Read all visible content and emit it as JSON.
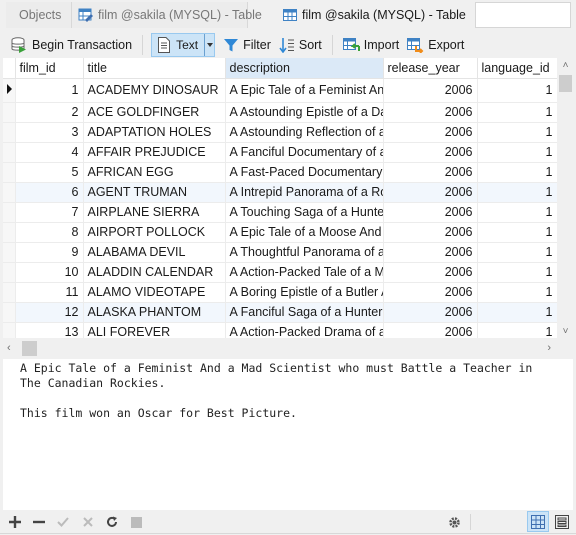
{
  "tabs": [
    {
      "label": "Objects",
      "icon": "none",
      "active": false
    },
    {
      "label": "film @sakila (MYSQL) - Table",
      "icon": "table-design-icon",
      "active": false
    },
    {
      "label": "film @sakila (MYSQL) - Table",
      "icon": "table-icon",
      "active": true
    }
  ],
  "toolbar": {
    "begin_transaction": "Begin Transaction",
    "text": "Text",
    "filter": "Filter",
    "sort": "Sort",
    "import": "Import",
    "export": "Export"
  },
  "grid": {
    "columns": [
      "film_id",
      "title",
      "description",
      "release_year",
      "language_id"
    ],
    "selected_column": "description",
    "rows": [
      {
        "film_id": "1",
        "title": "ACADEMY DINOSAUR",
        "description": "A Epic Tale of a Feminist And",
        "release_year": "2006",
        "language_id": "1"
      },
      {
        "film_id": "2",
        "title": "ACE GOLDFINGER",
        "description": "A Astounding Epistle of a Dat",
        "release_year": "2006",
        "language_id": "1"
      },
      {
        "film_id": "3",
        "title": "ADAPTATION HOLES",
        "description": "A Astounding Reflection of a",
        "release_year": "2006",
        "language_id": "1"
      },
      {
        "film_id": "4",
        "title": "AFFAIR PREJUDICE",
        "description": "A Fanciful Documentary of a",
        "release_year": "2006",
        "language_id": "1"
      },
      {
        "film_id": "5",
        "title": "AFRICAN EGG",
        "description": "A Fast-Paced Documentary of",
        "release_year": "2006",
        "language_id": "1"
      },
      {
        "film_id": "6",
        "title": "AGENT TRUMAN",
        "description": "A Intrepid Panorama of a Rob",
        "release_year": "2006",
        "language_id": "1"
      },
      {
        "film_id": "7",
        "title": "AIRPLANE SIERRA",
        "description": "A Touching Saga of a Hunter",
        "release_year": "2006",
        "language_id": "1"
      },
      {
        "film_id": "8",
        "title": "AIRPORT POLLOCK",
        "description": "A Epic Tale of a Moose And a",
        "release_year": "2006",
        "language_id": "1"
      },
      {
        "film_id": "9",
        "title": "ALABAMA DEVIL",
        "description": "A Thoughtful Panorama of a l",
        "release_year": "2006",
        "language_id": "1"
      },
      {
        "film_id": "10",
        "title": "ALADDIN CALENDAR",
        "description": "A Action-Packed Tale of a Ma",
        "release_year": "2006",
        "language_id": "1"
      },
      {
        "film_id": "11",
        "title": "ALAMO VIDEOTAPE",
        "description": "A Boring Epistle of a Butler Ar",
        "release_year": "2006",
        "language_id": "1"
      },
      {
        "film_id": "12",
        "title": "ALASKA PHANTOM",
        "description": "A Fanciful Saga of a Hunter A",
        "release_year": "2006",
        "language_id": "1"
      },
      {
        "film_id": "13",
        "title": "ALI FOREVER",
        "description": "A Action-Packed Drama of a l",
        "release_year": "2006",
        "language_id": "1"
      }
    ],
    "current_row": 1
  },
  "detail": {
    "text": "A Epic Tale of a Feminist And a Mad Scientist who must Battle a Teacher in\nThe Canadian Rockies.\n\nThis film won an Oscar for Best Picture."
  },
  "bottombar": {
    "icons": [
      "plus-icon",
      "minus-icon",
      "check-icon",
      "cross-icon",
      "refresh-icon",
      "stop-icon",
      "gear-icon",
      "grid-view-icon",
      "form-view-icon"
    ],
    "active_view": "grid-view"
  },
  "colors": {
    "accent_selected": "#cce4f7",
    "header_selected": "#dbe9f7",
    "row_alt": "#f2f7fd"
  }
}
